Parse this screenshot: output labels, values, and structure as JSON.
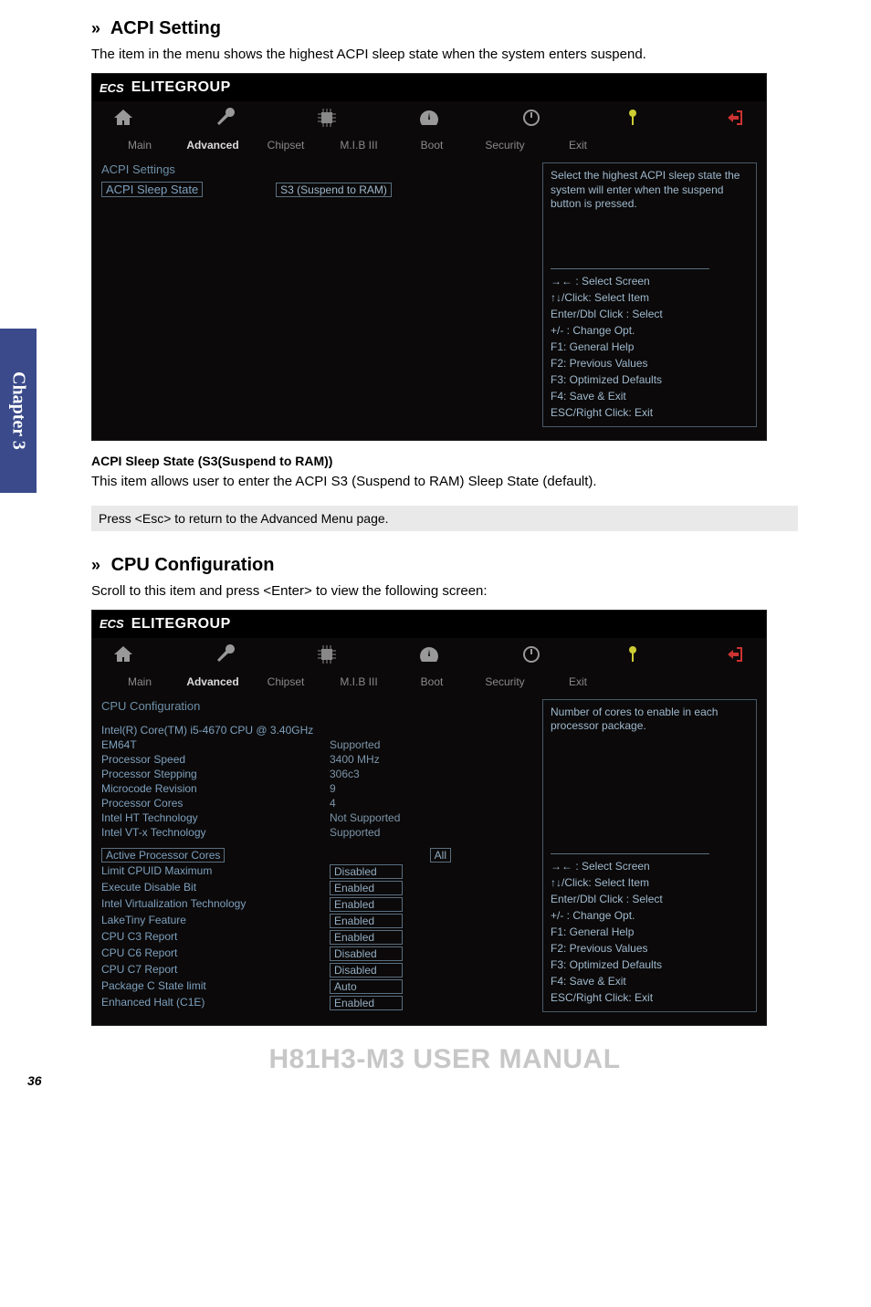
{
  "chapterTab": "Chapter 3",
  "acpiSection": {
    "title": "ACPI Setting",
    "intro": "The item in the menu shows the highest ACPI sleep state when the system enters suspend."
  },
  "bios1": {
    "brandLogo": "ECS",
    "brandText": "ELITEGROUP",
    "tabs": [
      "Main",
      "Advanced",
      "Chipset",
      "M.I.B III",
      "Boot",
      "Security",
      "Exit"
    ],
    "sectionTitle": "ACPI Settings",
    "row": {
      "label": "ACPI Sleep State",
      "value": "S3 (Suspend to RAM)"
    },
    "help": {
      "top": "Select the highest ACPI sleep state the system will enter when the suspend button is pressed.",
      "nav": [
        "→← : Select Screen",
        "↑↓/Click: Select Item",
        "Enter/Dbl Click : Select",
        "+/- : Change Opt.",
        "F1: General Help",
        "F2: Previous Values",
        "F3: Optimized Defaults",
        "F4: Save & Exit",
        "ESC/Right Click: Exit"
      ]
    }
  },
  "acpiItem": {
    "title": "ACPI Sleep State (S3(Suspend to RAM))",
    "text": "This item allows user to enter the ACPI S3 (Suspend to RAM) Sleep State (default)."
  },
  "escNote": "Press <Esc> to return to the Advanced Menu page.",
  "cpuSection": {
    "title": "CPU Configuration",
    "intro": "Scroll to this item and press <Enter> to view the following screen:"
  },
  "bios2": {
    "brandLogo": "ECS",
    "brandText": "ELITEGROUP",
    "tabs": [
      "Main",
      "Advanced",
      "Chipset",
      "M.I.B III",
      "Boot",
      "Security",
      "Exit"
    ],
    "sectionTitle": "CPU Configuration",
    "cpuName": "Intel(R) Core(TM) i5-4670 CPU @  3.40GHz",
    "rows": [
      {
        "label": "EM64T",
        "value": "Supported"
      },
      {
        "label": "Processor Speed",
        "value": "3400 MHz"
      },
      {
        "label": "Processor Stepping",
        "value": "306c3"
      },
      {
        "label": "Microcode Revision",
        "value": "9"
      },
      {
        "label": "Processor Cores",
        "value": "4"
      },
      {
        "label": "Intel HT Technology",
        "value": "Not Supported"
      },
      {
        "label": "Intel VT-x Technology",
        "value": "Supported"
      }
    ],
    "boxedRows": [
      {
        "label": "Active Processor Cores",
        "value": "All"
      },
      {
        "label": "Limit CPUID Maximum",
        "value": "Disabled"
      },
      {
        "label": "Execute Disable Bit",
        "value": "Enabled"
      },
      {
        "label": "Intel Virtualization Technology",
        "value": "Enabled"
      },
      {
        "label": "LakeTiny Feature",
        "value": "Enabled"
      },
      {
        "label": "CPU C3 Report",
        "value": "Enabled"
      },
      {
        "label": "CPU C6 Report",
        "value": "Disabled"
      },
      {
        "label": "CPU C7 Report",
        "value": "Disabled"
      },
      {
        "label": "Package C State limit",
        "value": "Auto"
      },
      {
        "label": "Enhanced Halt (C1E)",
        "value": "Enabled"
      }
    ],
    "help": {
      "top": "Number of cores to enable in each processor package.",
      "nav": [
        "→← : Select Screen",
        "↑↓/Click: Select Item",
        "Enter/Dbl Click : Select",
        "+/- : Change Opt.",
        "F1: General Help",
        "F2: Previous Values",
        "F3: Optimized Defaults",
        "F4: Save & Exit",
        "ESC/Right Click: Exit"
      ]
    }
  },
  "manualTitle": "H81H3-M3 USER MANUAL",
  "pageNum": "36"
}
